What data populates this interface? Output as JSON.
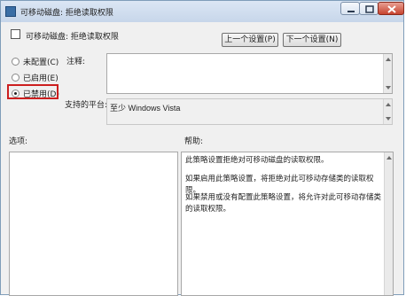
{
  "window": {
    "title": "可移动磁盘: 拒绝读取权限"
  },
  "header": {
    "setting_title": "可移动磁盘: 拒绝读取权限",
    "prev_label": "上一个设置(P)",
    "next_label": "下一个设置(N)"
  },
  "state": {
    "options": [
      {
        "label": "未配置(C)",
        "selected": false
      },
      {
        "label": "已启用(E)",
        "selected": false
      },
      {
        "label": "已禁用(D)",
        "selected": true
      }
    ]
  },
  "comment": {
    "label": "注释:",
    "value": ""
  },
  "platform": {
    "label": "支持的平台:",
    "value": "至少 Windows Vista"
  },
  "options_section": {
    "label": "选项:"
  },
  "help": {
    "label": "帮助:",
    "paragraphs": [
      "此策略设置拒绝对可移动磁盘的读取权限。",
      "如果启用此策略设置，将拒绝对此可移动存储类的读取权限。",
      "如果禁用或没有配置此策略设置，将允许对此可移动存储类的读取权限。"
    ]
  },
  "icons": {
    "window_icon": "policy-window-icon",
    "setting_icon": "policy-setting-icon",
    "minimize": "minimize-icon",
    "maximize": "maximize-icon",
    "close": "close-icon"
  },
  "colors": {
    "highlight": "#cc1f1f",
    "titlebar": "#c7d6ea"
  }
}
